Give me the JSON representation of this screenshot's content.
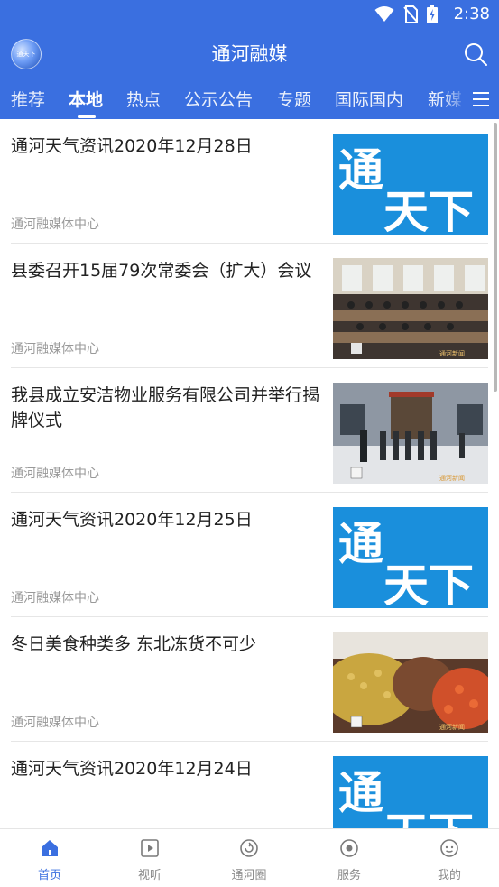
{
  "status_bar": {
    "time": "2:38"
  },
  "header": {
    "title": "通河融媒",
    "logo_text": "通天下"
  },
  "tabs": [
    {
      "label": "推荐"
    },
    {
      "label": "本地",
      "active": true
    },
    {
      "label": "热点"
    },
    {
      "label": "公示公告"
    },
    {
      "label": "专题"
    },
    {
      "label": "国际国内"
    },
    {
      "label": "新媒"
    }
  ],
  "brand_thumb_text": {
    "line1": "通",
    "line2": "天下"
  },
  "video_watermark": "通河新闻",
  "articles": [
    {
      "title": "通河天气资讯2020年12月28日",
      "source": "通河融媒体中心",
      "thumb": "brand"
    },
    {
      "title": "县委召开15届79次常委会（扩大）会议",
      "source": "通河融媒体中心",
      "thumb": "meeting"
    },
    {
      "title": "我县成立安洁物业服务有限公司并举行揭牌仪式",
      "source": "通河融媒体中心",
      "thumb": "ceremony"
    },
    {
      "title": "通河天气资讯2020年12月25日",
      "source": "通河融媒体中心",
      "thumb": "brand"
    },
    {
      "title": "冬日美食种类多 东北冻货不可少",
      "source": "通河融媒体中心",
      "thumb": "fruit"
    },
    {
      "title": "通河天气资讯2020年12月24日",
      "source": "",
      "thumb": "brand"
    }
  ],
  "bottom_nav": [
    {
      "label": "首页",
      "icon": "home-icon",
      "active": true
    },
    {
      "label": "视听",
      "icon": "video-icon"
    },
    {
      "label": "通河圈",
      "icon": "circle-icon"
    },
    {
      "label": "服务",
      "icon": "service-icon"
    },
    {
      "label": "我的",
      "icon": "profile-icon"
    }
  ],
  "colors": {
    "primary": "#3a6fe0",
    "brand_blue": "#1a8fdc",
    "text": "#222222",
    "muted": "#999999"
  }
}
